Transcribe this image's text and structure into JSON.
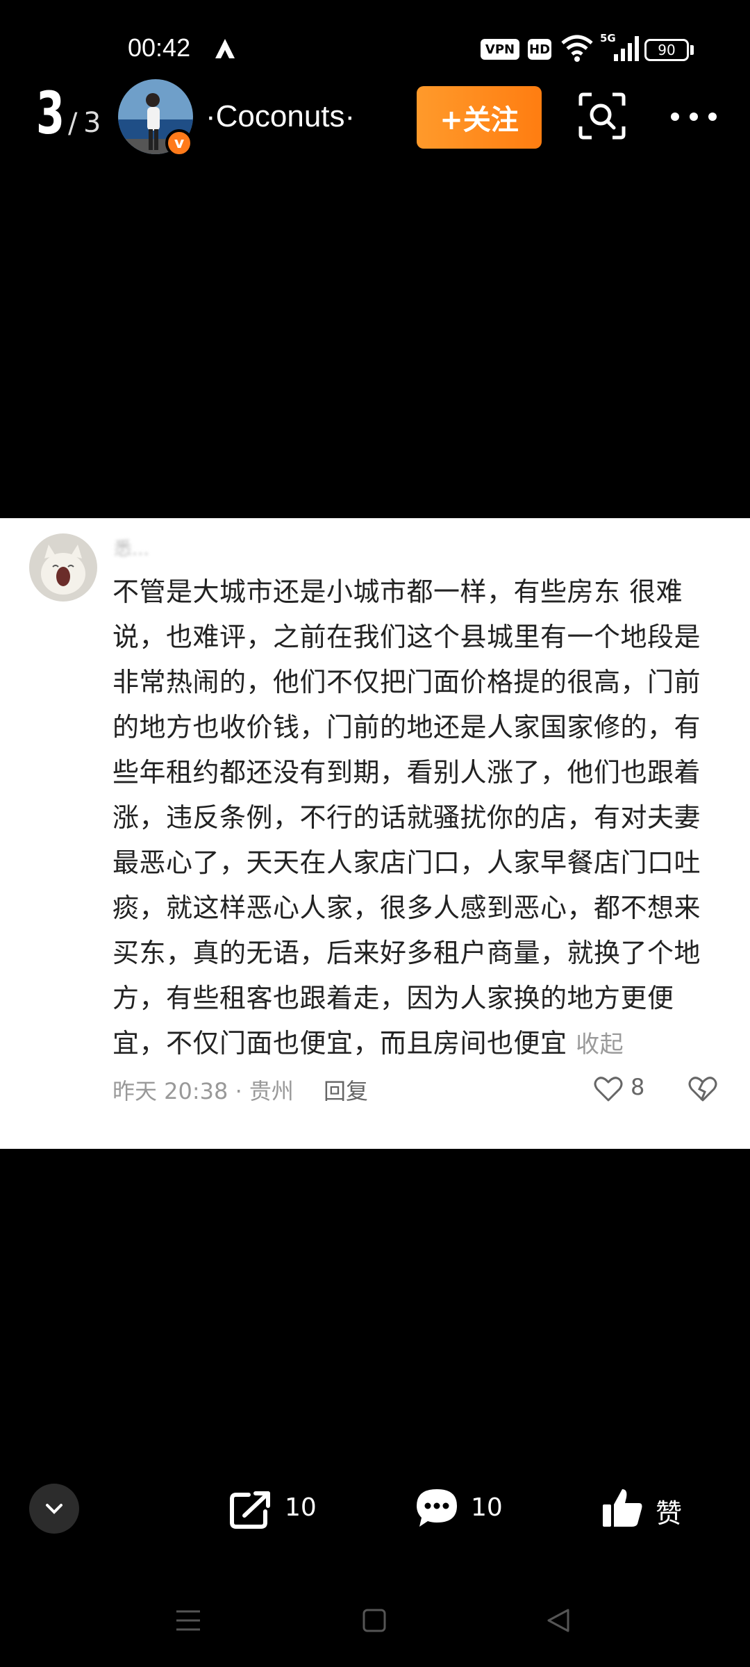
{
  "status_bar": {
    "time": "00:42",
    "vpn_label": "VPN",
    "hd_label": "HD",
    "network": "5G",
    "battery": "90"
  },
  "header": {
    "page_current": "3",
    "page_separator": "/",
    "page_total": "3",
    "username": "·Coconuts·",
    "verified_mark": "v",
    "follow_label": "+关注"
  },
  "comment": {
    "username": "悉...",
    "text": "不管是大城市还是小城市都一样，有些房东 很难说，也难评，之前在我们这个县城里有一个地段是非常热闹的，他们不仅把门面价格提的很高，门前的地方也收价钱，门前的地还是人家国家修的，有些年租约都还没有到期，看别人涨了，他们也跟着涨，违反条例，不行的话就骚扰你的店，有对夫妻最恶心了，天天在人家店门口，人家早餐店门口吐痰，就这样恶心人家，很多人感到恶心，都不想来买东，真的无语，后来好多租户商量，就换了个地方，有些租客也跟着走，因为人家换的地方更便宜，不仅门面也便宜，而且房间也便宜",
    "collapse_label": "收起",
    "meta": "昨天 20:38 · 贵州",
    "reply_label": "回复",
    "like_count": "8"
  },
  "actions": {
    "share_count": "10",
    "comment_count": "10",
    "like_label": "赞"
  },
  "colors": {
    "follow_accent": "#ff8a1f",
    "badge": "#ff7a1a"
  }
}
